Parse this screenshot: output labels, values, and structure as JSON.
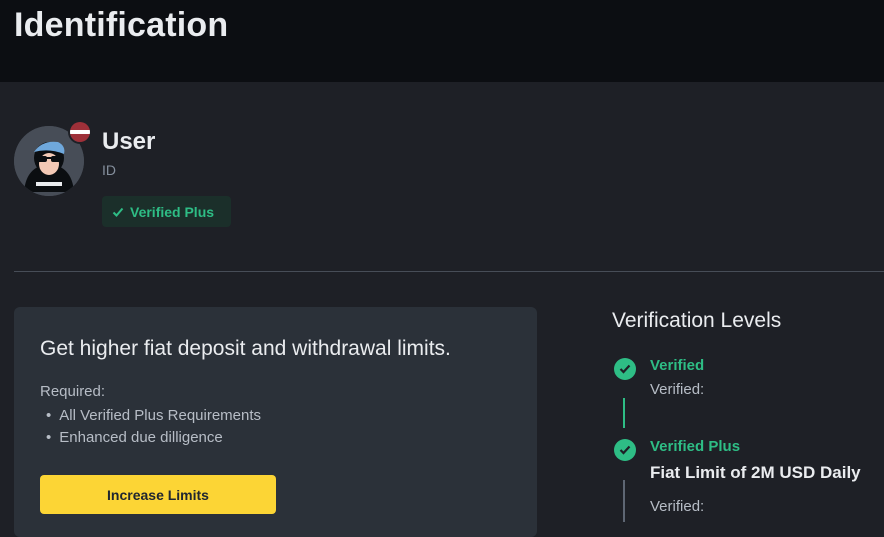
{
  "header": {
    "title": "Identification"
  },
  "profile": {
    "name": "User",
    "id_label": "ID",
    "badge": "Verified Plus",
    "avatar_icon": "avatar-icon",
    "flag_icon": "flag-icon"
  },
  "card": {
    "title": "Get higher fiat deposit and withdrawal limits.",
    "required_label": "Required:",
    "requirements": [
      "All Verified Plus Requirements",
      "Enhanced due dilligence"
    ],
    "button_label": "Increase Limits"
  },
  "levels": {
    "title": "Verification Levels",
    "items": [
      {
        "name": "Verified",
        "detail": "Verified:"
      },
      {
        "name": "Verified Plus",
        "limit": "Fiat Limit of 2M USD Daily",
        "detail": "Verified:"
      }
    ]
  },
  "colors": {
    "accent_yellow": "#fcd535",
    "success_green": "#2ebd85",
    "background": "#1e2026",
    "header_bg": "#0c0e12",
    "card_bg": "#2b3139"
  }
}
